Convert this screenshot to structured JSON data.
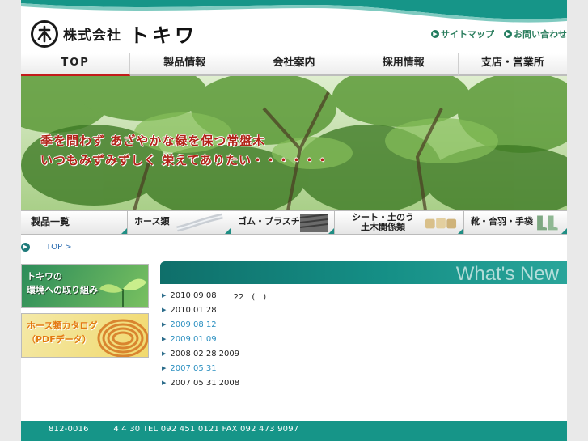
{
  "header": {
    "logo_kanji": "株式会社",
    "logo_brand": "トキワ",
    "links": [
      {
        "label": "サイトマップ"
      },
      {
        "label": "お問い合わせ"
      }
    ]
  },
  "nav": {
    "items": [
      {
        "label": "TOP",
        "active": true
      },
      {
        "label": "製品情報"
      },
      {
        "label": "会社案内"
      },
      {
        "label": "採用情報"
      },
      {
        "label": "支店・営業所"
      }
    ]
  },
  "hero": {
    "line1": "季を問わず あざやかな緑を保つ常盤木",
    "line2": "いつもみずみずしく 栄えてありたい・・・・・・"
  },
  "products": {
    "items": [
      {
        "label": "製品一覧"
      },
      {
        "label": "ホース類"
      },
      {
        "label": "ゴム・プラスチック類"
      },
      {
        "label": "シート・土のう 土木関係類"
      },
      {
        "label": "靴・合羽・手袋"
      }
    ]
  },
  "breadcrumb": {
    "label": "TOP >"
  },
  "banners": [
    {
      "line1": "トキワの",
      "line2": "環境への取り組み"
    },
    {
      "line1": "ホース類カタログ",
      "line2": "（PDFデータ）"
    }
  ],
  "whats_new": {
    "title": "What's New",
    "items": [
      {
        "date": "2010 09 08",
        "extra": "22　(　)"
      },
      {
        "date": "2010 01 28",
        "extra": ""
      },
      {
        "date": "2009 08 12",
        "extra": ""
      },
      {
        "date": "2009 01 09",
        "extra": ""
      },
      {
        "date": "2008 02 28",
        "extra": "2009"
      },
      {
        "date": "2007 05 31",
        "extra": ""
      },
      {
        "date": "2007 05 31",
        "extra": "2008"
      }
    ]
  },
  "footer": {
    "text": "812-0016　　　4  4 30 TEL 092 451 0121 FAX 092 473 9097"
  },
  "colors": {
    "accent": "#169588",
    "nav_active": "#c31b1b",
    "hero_text": "#b22318"
  }
}
